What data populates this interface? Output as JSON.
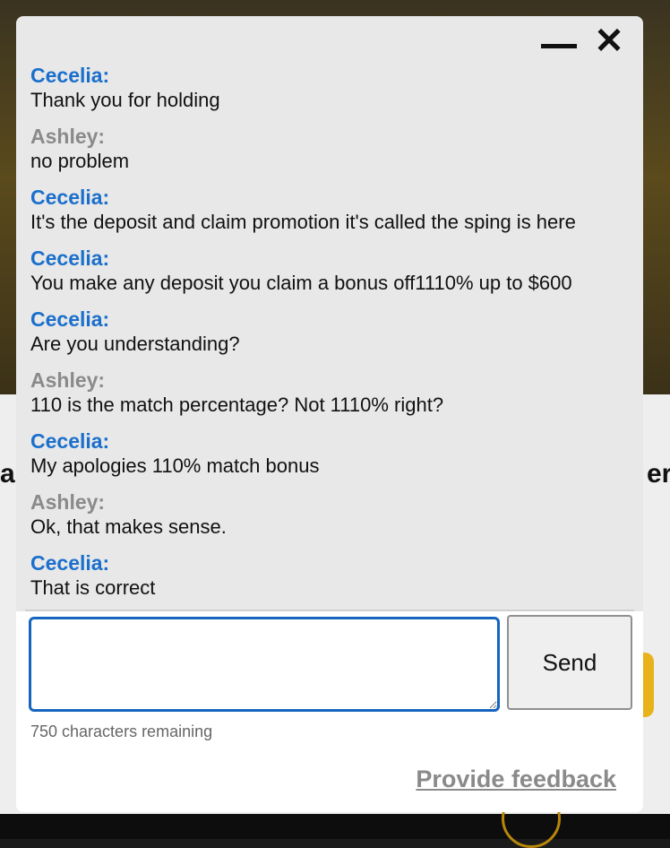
{
  "window": {
    "minimize_icon": "minimize-icon",
    "close_icon": "close-icon",
    "close_glyph": "✕"
  },
  "colors": {
    "agent_name": "#1a6fcc",
    "user_name": "#8a8a8a",
    "input_border": "#1565c0"
  },
  "messages": [
    {
      "speaker": "Cecelia:",
      "role": "agent",
      "text": "Thank you for holding"
    },
    {
      "speaker": "Ashley:",
      "role": "user",
      "text": "no problem"
    },
    {
      "speaker": "Cecelia:",
      "role": "agent",
      "text": "It's the deposit and claim promotion it's called the sping is here"
    },
    {
      "speaker": "Cecelia:",
      "role": "agent",
      "text": "You make any deposit you claim a bonus off1110% up to $600"
    },
    {
      "speaker": "Cecelia:",
      "role": "agent",
      "text": "Are you understanding?"
    },
    {
      "speaker": "Ashley:",
      "role": "user",
      "text": "110 is the match percentage? Not 1110% right?"
    },
    {
      "speaker": "Cecelia:",
      "role": "agent",
      "text": "My apologies 110% match bonus"
    },
    {
      "speaker": "Ashley:",
      "role": "user",
      "text": "Ok, that makes sense."
    },
    {
      "speaker": "Cecelia:",
      "role": "agent",
      "text": "That is correct"
    }
  ],
  "composer": {
    "value": "",
    "send_label": "Send",
    "remaining": "750 characters remaining"
  },
  "feedback_label": "Provide feedback"
}
